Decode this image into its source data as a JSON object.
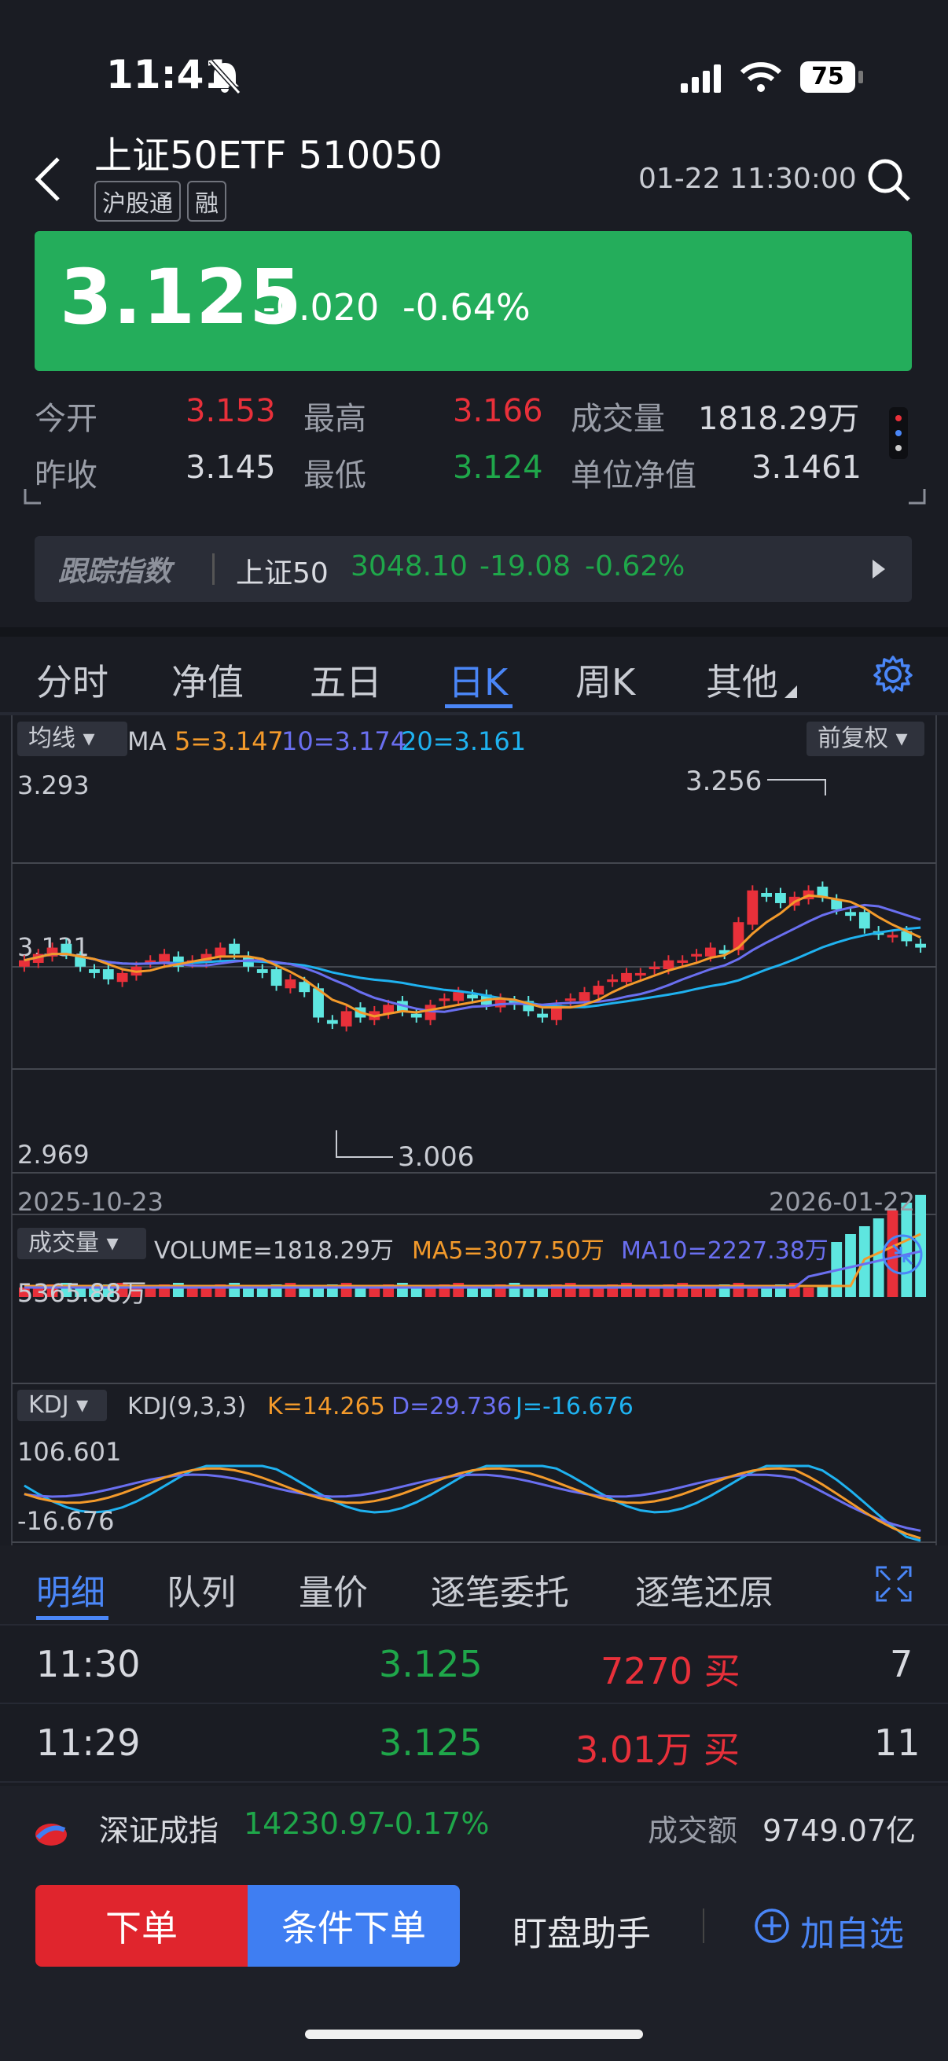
{
  "status_bar": {
    "time": "11:41",
    "battery": "75"
  },
  "header": {
    "title": "上证50ETF 510050",
    "tags": [
      "沪股通",
      "融"
    ],
    "datetime": "01-22 11:30:00"
  },
  "quote": {
    "price": "3.125",
    "change": "-0.020",
    "change_pct": "-0.64%",
    "open_label": "今开",
    "open": "3.153",
    "high_label": "最高",
    "high": "3.166",
    "volume_label": "成交量",
    "volume": "1818.29万",
    "prev_close_label": "昨收",
    "prev_close": "3.145",
    "low_label": "最低",
    "low": "3.124",
    "nav_label": "单位净值",
    "nav": "3.1461"
  },
  "tracking": {
    "label": "跟踪指数",
    "index_name": "上证50",
    "value": "3048.10",
    "change": "-19.08",
    "pct": "-0.62%"
  },
  "chart_tabs": [
    "分时",
    "净值",
    "五日",
    "日K",
    "周K",
    "其他"
  ],
  "active_tab": "日K",
  "kline": {
    "ma_button": "均线",
    "ma_label": "MA",
    "ma5": "5=3.147",
    "ma10": "10=3.174",
    "ma20": "20=3.161",
    "adjust_button": "前复权",
    "y_top": "3.293",
    "y_mid": "3.131",
    "y_bottom": "2.969",
    "high_marker": "3.256",
    "low_marker": "3.006",
    "date_start": "2025-10-23",
    "date_end": "2026-01-22"
  },
  "volume_panel": {
    "button": "成交量",
    "volume": "VOLUME=1818.29万",
    "ma5": "MA5=3077.50万",
    "ma10": "MA10=2227.38万",
    "y_max": "5365.88万"
  },
  "kdj_panel": {
    "button": "KDJ",
    "params": "KDJ(9,3,3)",
    "k": "K=14.265",
    "d": "D=29.736",
    "j": "J=-16.676",
    "y_top": "106.601",
    "y_bottom": "-16.676"
  },
  "detail_tabs": [
    "明细",
    "队列",
    "量价",
    "逐笔委托",
    "逐笔还原"
  ],
  "trades": [
    {
      "time": "11:30",
      "price": "3.125",
      "volume": "7270 买",
      "count": "7"
    },
    {
      "time": "11:29",
      "price": "3.125",
      "volume": "3.01万 买",
      "count": "11"
    }
  ],
  "footer": {
    "index_name": "深证成指",
    "index_value": "14230.97",
    "index_pct": "-0.17%",
    "turnover_label": "成交额",
    "turnover": "9749.07亿",
    "order": "下单",
    "conditional_order": "条件下单",
    "monitor": "盯盘助手",
    "add_watch": "加自选"
  },
  "colors": {
    "up": "#e8303a",
    "down": "#1fa74a",
    "candle_down": "#5ee6e0",
    "accent": "#4a86f7",
    "ma5": "#f39a2b",
    "ma10": "#6a6ff0",
    "ma20": "#1fb2f0"
  }
}
